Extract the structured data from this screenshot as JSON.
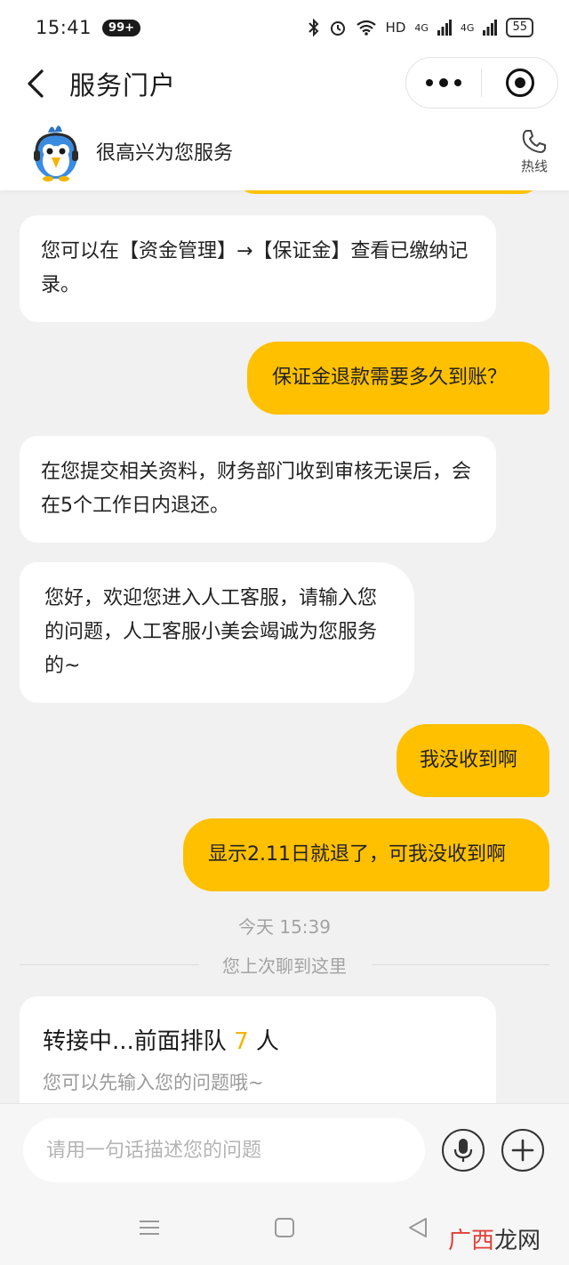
{
  "status_bar": {
    "time": "15:41",
    "notification_badge": "99+",
    "network": "HD",
    "signal_1": "4G",
    "signal_2": "4G",
    "battery": "55"
  },
  "header": {
    "title": "服务门户",
    "icons": {
      "back": "back-arrow-icon",
      "more": "more-dots-icon",
      "close": "close-target-icon"
    }
  },
  "service_bar": {
    "greeting": "很高兴为您服务",
    "hotline_label": "热线",
    "icons": {
      "avatar": "bird-mascot-icon",
      "phone": "phone-icon"
    }
  },
  "messages": [
    {
      "side": "left",
      "text": "您可以在【资金管理】→【保证金】查看已缴纳记录。"
    },
    {
      "side": "right",
      "text": "保证金退款需要多久到账？"
    },
    {
      "side": "left",
      "text": "在您提交相关资料，财务部门收到审核无误后，会在5个工作日内退还。"
    },
    {
      "side": "left",
      "text": "您好，欢迎您进入人工客服，请输入您的问题，人工客服小美会竭诚为您服务的~"
    },
    {
      "side": "right",
      "text": "我没收到啊"
    },
    {
      "side": "right",
      "text": "显示2.11日就退了，可我没收到啊"
    }
  ],
  "timestamp": "今天 15:39",
  "history_divider": "您上次聊到这里",
  "queue": {
    "prefix": "转接中...前面排队 ",
    "count": "7",
    "suffix": " 人",
    "hint": "您可以先输入您的问题哦~"
  },
  "input": {
    "placeholder": "请用一句话描述您的问题",
    "value": "",
    "icons": {
      "voice": "microphone-icon",
      "plus": "plus-icon"
    }
  },
  "watermark": {
    "part1": "广西",
    "part2": "龙网"
  },
  "colors": {
    "accent": "#ffc000",
    "queue_number": "#f6b400",
    "background": "#f1f1f1",
    "watermark_red": "#e0403a"
  }
}
